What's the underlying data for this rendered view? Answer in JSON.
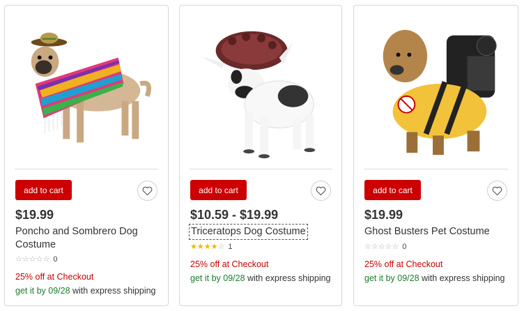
{
  "products": [
    {
      "price": "$19.99",
      "title": "Poncho and Sombrero Dog Costume",
      "rating_stars": 0,
      "review_count": "0",
      "promo": "25% off at Checkout",
      "ship_prefix": "get it by 09/28",
      "ship_suffix": " with express shipping",
      "add_label": "add to cart",
      "image_icon": "pug-poncho-sombrero-image"
    },
    {
      "price": "$10.59 - $19.99",
      "title": "Triceratops Dog Costume",
      "rating_stars": 4,
      "review_count": "1",
      "promo": "25% off at Checkout",
      "ship_prefix": "get it by 09/28",
      "ship_suffix": " with express shipping",
      "add_label": "add to cart",
      "image_icon": "bulldog-triceratops-image"
    },
    {
      "price": "$19.99",
      "title": "Ghost Busters Pet Costume",
      "rating_stars": 0,
      "review_count": "0",
      "promo": "25% off at Checkout",
      "ship_prefix": "get it by 09/28",
      "ship_suffix": " with express shipping",
      "add_label": "add to cart",
      "image_icon": "yorkie-ghostbusters-image"
    }
  ],
  "colors": {
    "add_button": "#cc0000",
    "promo": "#c80000",
    "ship_date": "#1c7c2e",
    "star_on": "#f2b600"
  }
}
